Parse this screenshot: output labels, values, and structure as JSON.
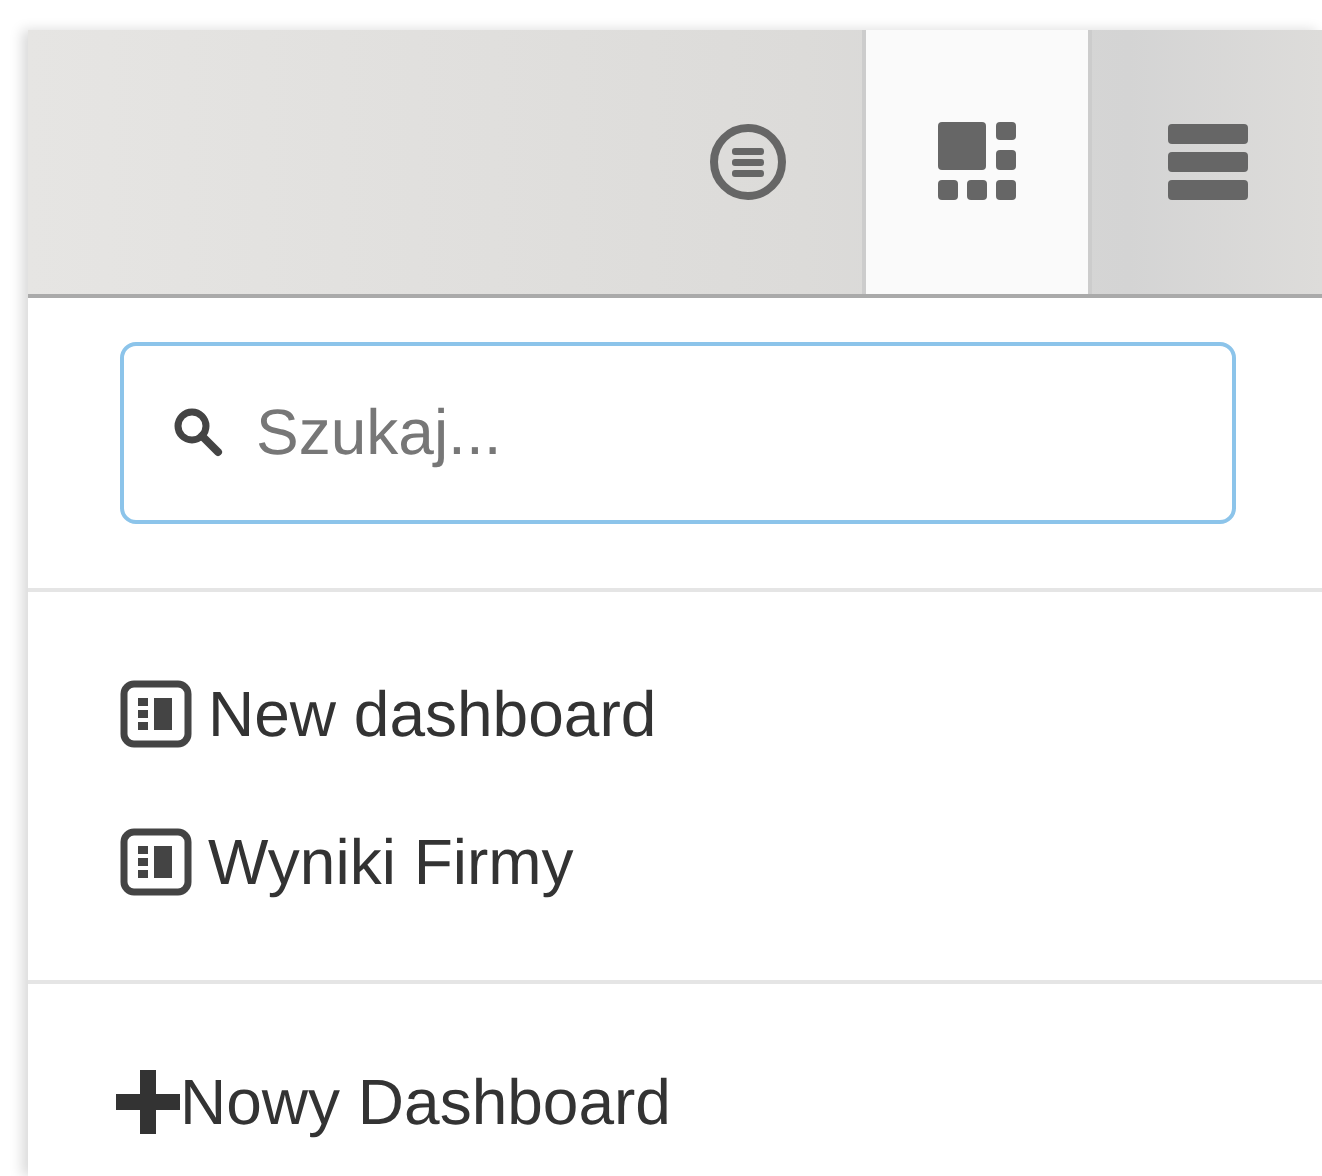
{
  "toolbar": {
    "buttons": [
      {
        "kind": "circle-list",
        "selected": false
      },
      {
        "kind": "tiles",
        "selected": true
      },
      {
        "kind": "menu",
        "selected": false
      }
    ]
  },
  "search": {
    "placeholder": "Szukaj..."
  },
  "dashboards": [
    {
      "label": "New dashboard"
    },
    {
      "label": "Wyniki Firmy"
    }
  ],
  "create_link": {
    "label": "Nowy Dashboard"
  }
}
